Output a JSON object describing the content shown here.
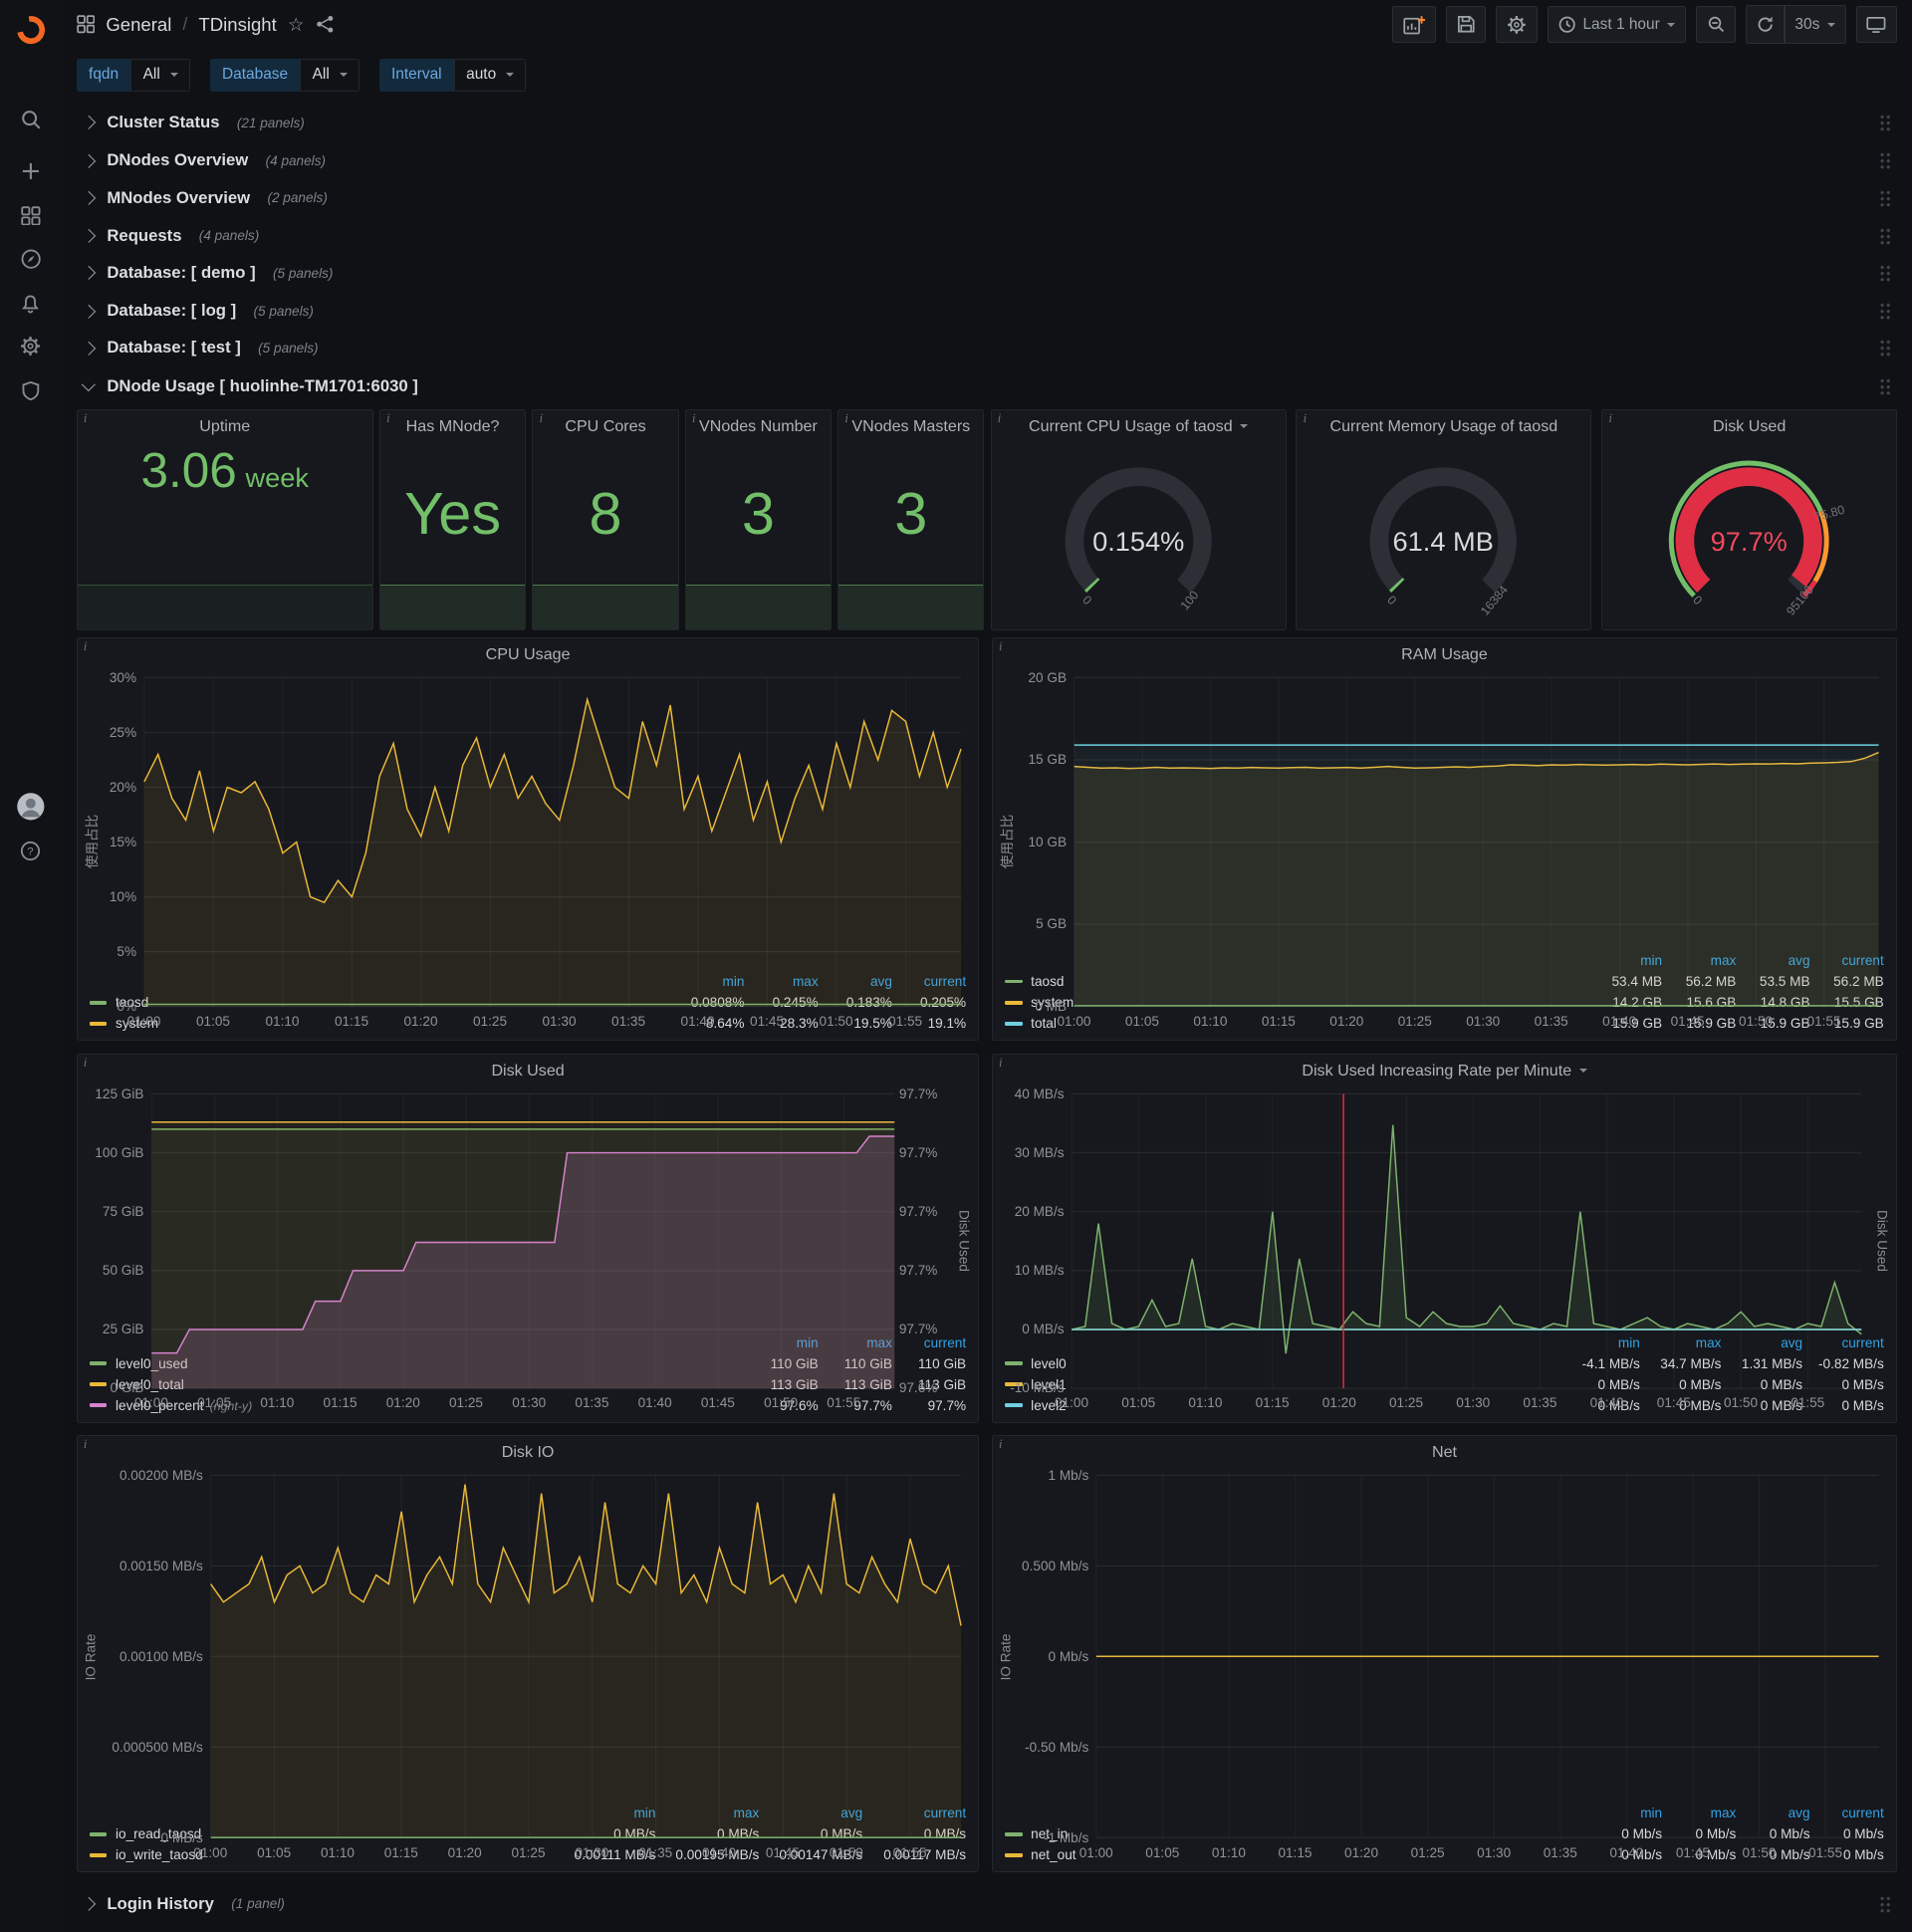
{
  "ui": {
    "star": "☆",
    "info": "i"
  },
  "nav": {
    "section": "General",
    "separator": "/",
    "page": "TDinsight",
    "time_range": "Last 1 hour",
    "refresh": "30s"
  },
  "variables": [
    {
      "label": "fqdn",
      "value": "All"
    },
    {
      "label": "Database",
      "value": "All"
    },
    {
      "label": "Interval",
      "value": "auto"
    }
  ],
  "rows": [
    {
      "title": "Cluster Status",
      "count": "(21 panels)"
    },
    {
      "title": "DNodes Overview",
      "count": "(4 panels)"
    },
    {
      "title": "MNodes Overview",
      "count": "(2 panels)"
    },
    {
      "title": "Requests",
      "count": "(4 panels)"
    },
    {
      "title": "Database: [ demo ]",
      "count": "(5 panels)"
    },
    {
      "title": "Database: [ log ]",
      "count": "(5 panels)"
    },
    {
      "title": "Database: [ test ]",
      "count": "(5 panels)"
    }
  ],
  "expanded_row": {
    "title": "DNode Usage [ huolinhe-TM1701:6030 ]"
  },
  "bottom_row": {
    "title": "Login History",
    "count": "(1 panel)"
  },
  "stats": [
    {
      "title": "Uptime",
      "value": "3.06",
      "unit": "week"
    },
    {
      "title": "Has MNode?",
      "value": "Yes"
    },
    {
      "title": "CPU Cores",
      "value": "8"
    },
    {
      "title": "VNodes Number",
      "value": "3"
    },
    {
      "title": "VNodes Masters",
      "value": "3"
    }
  ],
  "gauges": [
    {
      "title": "Current CPU Usage of taosd",
      "value": "0.154%",
      "min": "0",
      "max": "100",
      "percent": 0.154,
      "color": "#73BF69",
      "value_color": "#D8D9DA"
    },
    {
      "title": "Current Memory Usage of taosd",
      "value": "61.4 MB",
      "min": "0",
      "max": "16384",
      "percent": 0.375,
      "color": "#73BF69",
      "value_color": "#D8D9DA"
    },
    {
      "title": "Disk Used",
      "value": "97.7%",
      "min": "0",
      "max": "95100",
      "mid": "75.80",
      "percent": 97.7,
      "color": "#E02F44",
      "value_color": "#F2495C",
      "band": true
    }
  ],
  "time_ticks": [
    "01:00",
    "01:05",
    "01:10",
    "01:15",
    "01:20",
    "01:25",
    "01:30",
    "01:35",
    "01:40",
    "01:45",
    "01:50",
    "01:55"
  ],
  "graphs": {
    "cpu": {
      "type": "line",
      "title": "CPU Usage",
      "y_label": "使用占比",
      "y_ticks": [
        "30%",
        "25%",
        "20%",
        "15%",
        "10%",
        "5%",
        "0%"
      ],
      "yrange": [
        0,
        30
      ],
      "series": [
        {
          "name": "system",
          "color": "#EAB839",
          "fill": true,
          "fo": 0.09,
          "values": [
            20.5,
            23,
            19,
            17,
            21.5,
            16,
            20,
            19.5,
            20.5,
            18,
            14,
            15,
            10,
            9.5,
            11.5,
            10,
            14,
            21,
            24,
            18,
            15.5,
            20,
            16,
            22,
            24.5,
            20,
            23,
            19,
            21,
            18.5,
            17,
            22,
            28,
            24,
            20,
            19,
            26,
            22,
            27.5,
            18,
            21,
            16,
            19.5,
            23,
            17,
            20.5,
            15,
            19,
            22,
            18,
            24,
            20,
            26,
            22.5,
            27,
            26,
            21,
            25,
            20,
            23.5
          ]
        },
        {
          "name": "taosd",
          "color": "#7EB26D",
          "values": [
            0.2,
            0.2
          ]
        }
      ],
      "legend_cols": [
        "min",
        "max",
        "avg",
        "current"
      ],
      "legend": [
        {
          "name": "taosd",
          "color": "#7EB26D",
          "vals": [
            "0.0808%",
            "0.245%",
            "0.183%",
            "0.205%"
          ]
        },
        {
          "name": "system",
          "color": "#EAB839",
          "vals": [
            "8.64%",
            "28.3%",
            "19.5%",
            "19.1%"
          ]
        }
      ]
    },
    "ram": {
      "type": "line",
      "title": "RAM Usage",
      "y_label": "使用占比",
      "y_ticks": [
        "20 GB",
        "15 GB",
        "10 GB",
        "5 GB",
        "0 MB"
      ],
      "yrange": [
        0,
        20
      ],
      "series": [
        {
          "name": "system",
          "color": "#EAB839",
          "fill": true,
          "fo": 0.09,
          "values": [
            14.6,
            14.55,
            14.5,
            14.52,
            14.48,
            14.5,
            14.55,
            14.5,
            14.52,
            14.5,
            14.48,
            14.52,
            14.5,
            14.54,
            14.52,
            14.5,
            14.53,
            14.55,
            14.5,
            14.52,
            14.54,
            14.5,
            14.55,
            14.6,
            14.55,
            14.5,
            14.52,
            14.55,
            14.58,
            14.55,
            14.6,
            14.62,
            14.7,
            14.68,
            14.65,
            14.7,
            14.68,
            14.72,
            14.7,
            14.68,
            14.7,
            14.72,
            14.7,
            14.74,
            14.72,
            14.7,
            14.73,
            14.75,
            14.72,
            14.74,
            14.76,
            14.75,
            14.78,
            14.76,
            14.8,
            14.82,
            14.85,
            14.9,
            15.1,
            15.45
          ]
        },
        {
          "name": "total",
          "color": "#6ED0E0",
          "fill": true,
          "fo": 0.05,
          "values": [
            15.9,
            15.9
          ]
        },
        {
          "name": "taosd",
          "color": "#7EB26D",
          "values": [
            0.055,
            0.055
          ]
        }
      ],
      "legend_cols": [
        "min",
        "max",
        "avg",
        "current"
      ],
      "legend": [
        {
          "name": "taosd",
          "color": "#7EB26D",
          "vals": [
            "53.4 MB",
            "56.2 MB",
            "53.5 MB",
            "56.2 MB"
          ]
        },
        {
          "name": "system",
          "color": "#EAB839",
          "vals": [
            "14.2 GB",
            "15.6 GB",
            "14.8 GB",
            "15.5 GB"
          ]
        },
        {
          "name": "total",
          "color": "#6ED0E0",
          "vals": [
            "15.9 GB",
            "15.9 GB",
            "15.9 GB",
            "15.9 GB"
          ]
        }
      ]
    },
    "disk": {
      "type": "line",
      "title": "Disk Used",
      "y_ticks": [
        "125 GiB",
        "100 GiB",
        "75 GiB",
        "50 GiB",
        "25 GiB",
        "0 GiB"
      ],
      "right_ticks": [
        "97.7%",
        "97.7%",
        "97.7%",
        "97.7%",
        "97.7%",
        "97.6%"
      ],
      "right_label": "Disk Used",
      "yrange": [
        0,
        125
      ],
      "series": [
        {
          "name": "level0_used",
          "color": "#7EB26D",
          "fill": true,
          "fo": 0.07,
          "values": [
            110,
            110
          ]
        },
        {
          "name": "level0_total",
          "color": "#EAB839",
          "fill": true,
          "fo": 0.06,
          "values": [
            113,
            113
          ]
        },
        {
          "name": "level0_percent",
          "color": "#D683CE",
          "fill": true,
          "fo": 0.18,
          "yrange": [
            97.595,
            97.72
          ],
          "values": [
            97.61,
            97.61,
            97.61,
            97.62,
            97.62,
            97.62,
            97.62,
            97.62,
            97.62,
            97.62,
            97.62,
            97.62,
            97.62,
            97.632,
            97.632,
            97.632,
            97.645,
            97.645,
            97.645,
            97.645,
            97.645,
            97.657,
            97.657,
            97.657,
            97.657,
            97.657,
            97.657,
            97.657,
            97.657,
            97.657,
            97.657,
            97.657,
            97.657,
            97.695,
            97.695,
            97.695,
            97.695,
            97.695,
            97.695,
            97.695,
            97.695,
            97.695,
            97.695,
            97.695,
            97.695,
            97.695,
            97.695,
            97.695,
            97.695,
            97.695,
            97.695,
            97.695,
            97.695,
            97.695,
            97.695,
            97.695,
            97.695,
            97.702,
            97.702,
            97.702
          ]
        }
      ],
      "legend_cols": [
        "min",
        "max",
        "current"
      ],
      "legend": [
        {
          "name": "level0_used",
          "color": "#7EB26D",
          "vals": [
            "110 GiB",
            "110 GiB",
            "110 GiB"
          ]
        },
        {
          "name": "level0_total",
          "color": "#EAB839",
          "vals": [
            "113 GiB",
            "113 GiB",
            "113 GiB"
          ]
        },
        {
          "name": "level0_percent",
          "suffix": "(right-y)",
          "color": "#D683CE",
          "vals": [
            "97.6%",
            "97.7%",
            "97.7%"
          ]
        }
      ]
    },
    "rate": {
      "type": "line",
      "title": "Disk Used Increasing Rate per Minute",
      "y_ticks": [
        "40 MB/s",
        "30 MB/s",
        "20 MB/s",
        "10 MB/s",
        "0 MB/s",
        "-10 MB/s"
      ],
      "right_label": "Disk Used",
      "yrange": [
        -10,
        40
      ],
      "annotation": 20.3,
      "series": [
        {
          "name": "level0",
          "color": "#7EB26D",
          "fill": true,
          "fo": 0.12,
          "values": [
            0,
            0.5,
            18,
            1,
            0,
            0.5,
            5,
            0.5,
            1,
            12,
            0.5,
            0,
            1,
            0.5,
            0,
            20,
            -4.1,
            12,
            1,
            0.5,
            0,
            3,
            1,
            0.5,
            34.7,
            2,
            0.5,
            3,
            1,
            0.5,
            0.5,
            1,
            4,
            1,
            0.5,
            0,
            1,
            0.5,
            20,
            1,
            0.5,
            0,
            1,
            2,
            0.5,
            0,
            1,
            0.5,
            0,
            1,
            3,
            0.5,
            1,
            0.5,
            0,
            1,
            0.5,
            8,
            1,
            -0.82
          ]
        },
        {
          "name": "level1",
          "color": "#EAB839",
          "values": [
            0,
            0
          ]
        },
        {
          "name": "level2",
          "color": "#6ED0E0",
          "values": [
            0,
            0
          ]
        }
      ],
      "legend_cols": [
        "min",
        "max",
        "avg",
        "current"
      ],
      "legend": [
        {
          "name": "level0",
          "color": "#7EB26D",
          "vals": [
            "-4.1 MB/s",
            "34.7 MB/s",
            "1.31 MB/s",
            "-0.82 MB/s"
          ]
        },
        {
          "name": "level1",
          "color": "#EAB839",
          "vals": [
            "0 MB/s",
            "0 MB/s",
            "0 MB/s",
            "0 MB/s"
          ]
        },
        {
          "name": "level2",
          "color": "#6ED0E0",
          "vals": [
            "0 MB/s",
            "0 MB/s",
            "0 MB/s",
            "0 MB/s"
          ]
        }
      ]
    },
    "io": {
      "type": "line",
      "title": "Disk IO",
      "y_label": "IO Rate",
      "y_ticks": [
        "0.00200 MB/s",
        "0.00150 MB/s",
        "0.00100 MB/s",
        "0.000500 MB/s",
        "0 MB/s"
      ],
      "yrange": [
        0,
        0.002
      ],
      "series": [
        {
          "name": "io_write_taosd",
          "color": "#EAB839",
          "fill": true,
          "fo": 0.09,
          "values": [
            0.0014,
            0.0013,
            0.00135,
            0.0014,
            0.00155,
            0.0013,
            0.00145,
            0.0015,
            0.00135,
            0.0014,
            0.0016,
            0.00135,
            0.0013,
            0.00145,
            0.0014,
            0.0018,
            0.0013,
            0.00145,
            0.00155,
            0.0014,
            0.00195,
            0.0014,
            0.0013,
            0.0016,
            0.00145,
            0.0013,
            0.0019,
            0.00135,
            0.0014,
            0.00155,
            0.0013,
            0.00185,
            0.0014,
            0.00135,
            0.0015,
            0.0014,
            0.0019,
            0.00135,
            0.00145,
            0.0013,
            0.0016,
            0.0014,
            0.00135,
            0.00185,
            0.0014,
            0.00145,
            0.0013,
            0.0015,
            0.00135,
            0.0019,
            0.0014,
            0.00135,
            0.00155,
            0.0014,
            0.0013,
            0.00165,
            0.0014,
            0.00135,
            0.0015,
            0.00117
          ]
        },
        {
          "name": "io_read_taosd",
          "color": "#7EB26D",
          "values": [
            0,
            0
          ]
        }
      ],
      "legend_cols": [
        "min",
        "max",
        "avg",
        "current"
      ],
      "legend": [
        {
          "name": "io_read_taosd",
          "color": "#7EB26D",
          "vals": [
            "0 MB/s",
            "0 MB/s",
            "0 MB/s",
            "0 MB/s"
          ]
        },
        {
          "name": "io_write_taosd",
          "color": "#EAB839",
          "vals": [
            "0.00111 MB/s",
            "0.00195 MB/s",
            "0.00147 MB/s",
            "0.00117 MB/s"
          ]
        }
      ]
    },
    "net": {
      "type": "line",
      "title": "Net",
      "y_label": "IO Rate",
      "y_ticks": [
        "1 Mb/s",
        "0.500 Mb/s",
        "0 Mb/s",
        "-0.50 Mb/s",
        "-1 Mb/s"
      ],
      "yrange": [
        -1,
        1
      ],
      "series": [
        {
          "name": "net_in",
          "color": "#7EB26D",
          "values": [
            0,
            0
          ]
        },
        {
          "name": "net_out",
          "color": "#EAB839",
          "values": [
            0,
            0
          ]
        }
      ],
      "legend_cols": [
        "min",
        "max",
        "avg",
        "current"
      ],
      "legend": [
        {
          "name": "net_in",
          "color": "#7EB26D",
          "vals": [
            "0 Mb/s",
            "0 Mb/s",
            "0 Mb/s",
            "0 Mb/s"
          ]
        },
        {
          "name": "net_out",
          "color": "#EAB839",
          "vals": [
            "0 Mb/s",
            "0 Mb/s",
            "0 Mb/s",
            "0 Mb/s"
          ]
        }
      ]
    }
  }
}
